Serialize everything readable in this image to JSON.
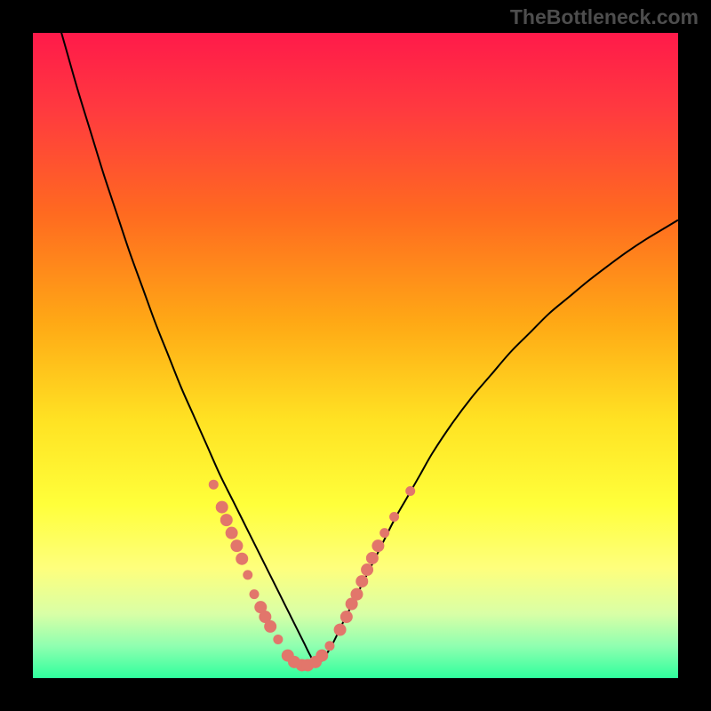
{
  "watermark": "TheBottleneck.com",
  "chart_data": {
    "type": "line",
    "title": "",
    "xlabel": "",
    "ylabel": "",
    "xlim": [
      0,
      100
    ],
    "ylim": [
      0,
      100
    ],
    "grid": false,
    "legend": false,
    "background_gradient_stops": [
      {
        "offset": 0.0,
        "color": "#ff1a4a"
      },
      {
        "offset": 0.12,
        "color": "#ff3a3f"
      },
      {
        "offset": 0.28,
        "color": "#ff6a20"
      },
      {
        "offset": 0.45,
        "color": "#ffa915"
      },
      {
        "offset": 0.6,
        "color": "#ffe223"
      },
      {
        "offset": 0.73,
        "color": "#ffff3a"
      },
      {
        "offset": 0.83,
        "color": "#feff7d"
      },
      {
        "offset": 0.9,
        "color": "#d9ffa6"
      },
      {
        "offset": 0.95,
        "color": "#90ffb0"
      },
      {
        "offset": 1.0,
        "color": "#2fff9d"
      }
    ],
    "series": [
      {
        "name": "bottleneck-curve",
        "color": "#000000",
        "stroke_width": 2.0,
        "x": [
          3,
          5,
          7,
          9,
          11,
          13,
          15,
          17,
          19,
          21,
          23,
          25,
          27,
          29,
          31,
          32,
          33,
          34,
          35,
          36,
          37,
          38,
          39,
          40,
          41,
          42,
          43,
          44,
          46,
          48,
          50,
          52,
          54,
          56,
          58,
          60,
          62,
          65,
          68,
          71,
          74,
          77,
          80,
          83,
          86,
          89,
          92,
          95,
          98,
          100
        ],
        "y": [
          105,
          98,
          91,
          84.5,
          78,
          72,
          66,
          60.5,
          55,
          50,
          45,
          40.5,
          36,
          31.5,
          27.5,
          25.5,
          23.5,
          21.5,
          19.5,
          17.5,
          15.5,
          13.5,
          11.5,
          9.5,
          7.5,
          5.5,
          3.5,
          2.0,
          4.5,
          8.5,
          12.5,
          16.5,
          20.5,
          24.5,
          28,
          31.5,
          35,
          39.5,
          43.5,
          47,
          50.5,
          53.5,
          56.5,
          59,
          61.5,
          63.8,
          66,
          68,
          69.8,
          71
        ]
      }
    ],
    "markers": {
      "name": "highlight-points",
      "color": "#e2766b",
      "radius_small": 5.5,
      "radius_large": 7.0,
      "points": [
        {
          "x": 28.0,
          "y": 30.0,
          "r": "small"
        },
        {
          "x": 29.3,
          "y": 26.5,
          "r": "large"
        },
        {
          "x": 30.0,
          "y": 24.5,
          "r": "large"
        },
        {
          "x": 30.8,
          "y": 22.5,
          "r": "large"
        },
        {
          "x": 31.6,
          "y": 20.5,
          "r": "large"
        },
        {
          "x": 32.4,
          "y": 18.5,
          "r": "large"
        },
        {
          "x": 33.3,
          "y": 16.0,
          "r": "small"
        },
        {
          "x": 34.3,
          "y": 13.0,
          "r": "small"
        },
        {
          "x": 35.3,
          "y": 11.0,
          "r": "large"
        },
        {
          "x": 36.0,
          "y": 9.5,
          "r": "large"
        },
        {
          "x": 36.8,
          "y": 8.0,
          "r": "large"
        },
        {
          "x": 38.0,
          "y": 6.0,
          "r": "small"
        },
        {
          "x": 39.5,
          "y": 3.5,
          "r": "large"
        },
        {
          "x": 40.5,
          "y": 2.5,
          "r": "large"
        },
        {
          "x": 41.7,
          "y": 2.0,
          "r": "large"
        },
        {
          "x": 42.6,
          "y": 2.0,
          "r": "large"
        },
        {
          "x": 43.8,
          "y": 2.5,
          "r": "large"
        },
        {
          "x": 44.8,
          "y": 3.5,
          "r": "large"
        },
        {
          "x": 46.0,
          "y": 5.0,
          "r": "small"
        },
        {
          "x": 47.6,
          "y": 7.5,
          "r": "large"
        },
        {
          "x": 48.6,
          "y": 9.5,
          "r": "large"
        },
        {
          "x": 49.4,
          "y": 11.5,
          "r": "large"
        },
        {
          "x": 50.2,
          "y": 13.0,
          "r": "large"
        },
        {
          "x": 51.0,
          "y": 15.0,
          "r": "large"
        },
        {
          "x": 51.8,
          "y": 16.8,
          "r": "large"
        },
        {
          "x": 52.6,
          "y": 18.6,
          "r": "large"
        },
        {
          "x": 53.5,
          "y": 20.5,
          "r": "large"
        },
        {
          "x": 54.5,
          "y": 22.5,
          "r": "small"
        },
        {
          "x": 56.0,
          "y": 25.0,
          "r": "small"
        },
        {
          "x": 58.5,
          "y": 29.0,
          "r": "small"
        }
      ]
    }
  }
}
